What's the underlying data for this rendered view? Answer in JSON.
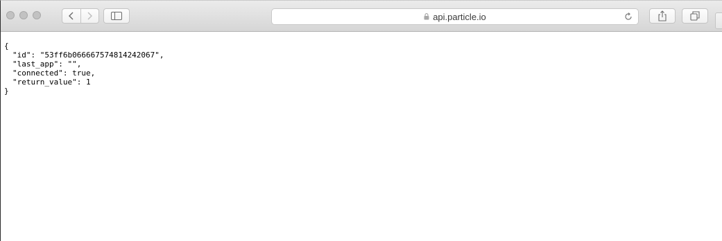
{
  "browser": {
    "url": "api.particle.io",
    "lock_icon": "lock-icon",
    "buttons": [
      "back-icon",
      "forward-icon",
      "sidebar-icon",
      "reload-icon",
      "share-icon",
      "tabs-icon"
    ]
  },
  "json_view": {
    "open_brace": "{",
    "lines": [
      "\"id\": \"53ff6b066667574814242067\",",
      "\"last_app\": \"\",",
      "\"connected\": true,",
      "\"return_value\": 1"
    ],
    "close_brace": "}"
  }
}
